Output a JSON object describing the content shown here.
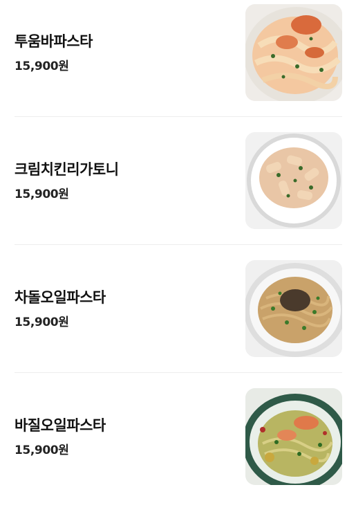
{
  "menu": {
    "items": [
      {
        "name": "투움바파스타",
        "price": "15,900원",
        "photo_icon": "tuscan-cream-pasta-photo"
      },
      {
        "name": "크림치킨리가토니",
        "price": "15,900원",
        "photo_icon": "cream-chicken-rigatoni-photo"
      },
      {
        "name": "차돌오일파스타",
        "price": "15,900원",
        "photo_icon": "beef-brisket-oil-pasta-photo"
      },
      {
        "name": "바질오일파스타",
        "price": "15,900원",
        "photo_icon": "basil-oil-pasta-photo"
      }
    ]
  }
}
